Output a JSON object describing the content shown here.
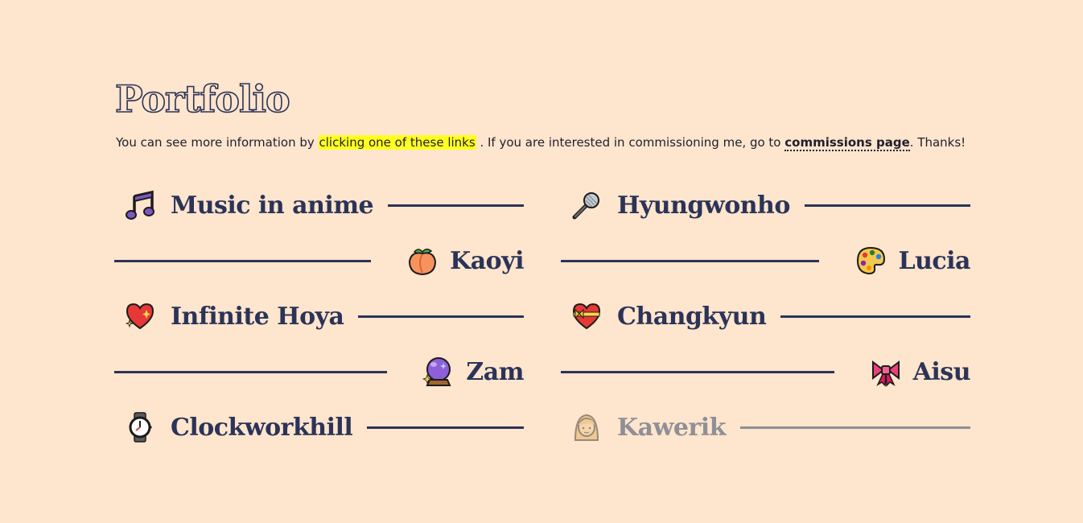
{
  "header": {
    "title": "Portfolio"
  },
  "intro": {
    "text_before": "You can see more information by ",
    "highlight_link": "clicking one of these links",
    "text_middle": " . If you are interested in commissioning me, go to ",
    "commissions_link": "commissions page",
    "text_after": ". Thanks!"
  },
  "portfolio": {
    "items": [
      {
        "name": "Music in anime",
        "icon": "musical-notes-icon",
        "align": "left"
      },
      {
        "name": "Hyungwonho",
        "icon": "microphone-icon",
        "align": "left"
      },
      {
        "name": "Kaoyi",
        "icon": "peach-icon",
        "align": "right"
      },
      {
        "name": "Lucia",
        "icon": "palette-icon",
        "align": "right"
      },
      {
        "name": "Infinite Hoya",
        "icon": "sparkling-heart-icon",
        "align": "left"
      },
      {
        "name": "Changkyun",
        "icon": "heart-with-ribbon-icon",
        "align": "left"
      },
      {
        "name": "Zam",
        "icon": "crystal-ball-icon",
        "align": "right"
      },
      {
        "name": "Aisu",
        "icon": "ribbon-bow-icon",
        "align": "right"
      },
      {
        "name": "Clockworkhill",
        "icon": "wristwatch-icon",
        "align": "left"
      },
      {
        "name": "Kawerik",
        "icon": "woman-icon",
        "align": "left",
        "disabled": true
      }
    ]
  },
  "colors": {
    "background": "#fee5cd",
    "navy": "#2b3358",
    "highlight": "#ffff1f",
    "disabled": "#8f8f96"
  }
}
